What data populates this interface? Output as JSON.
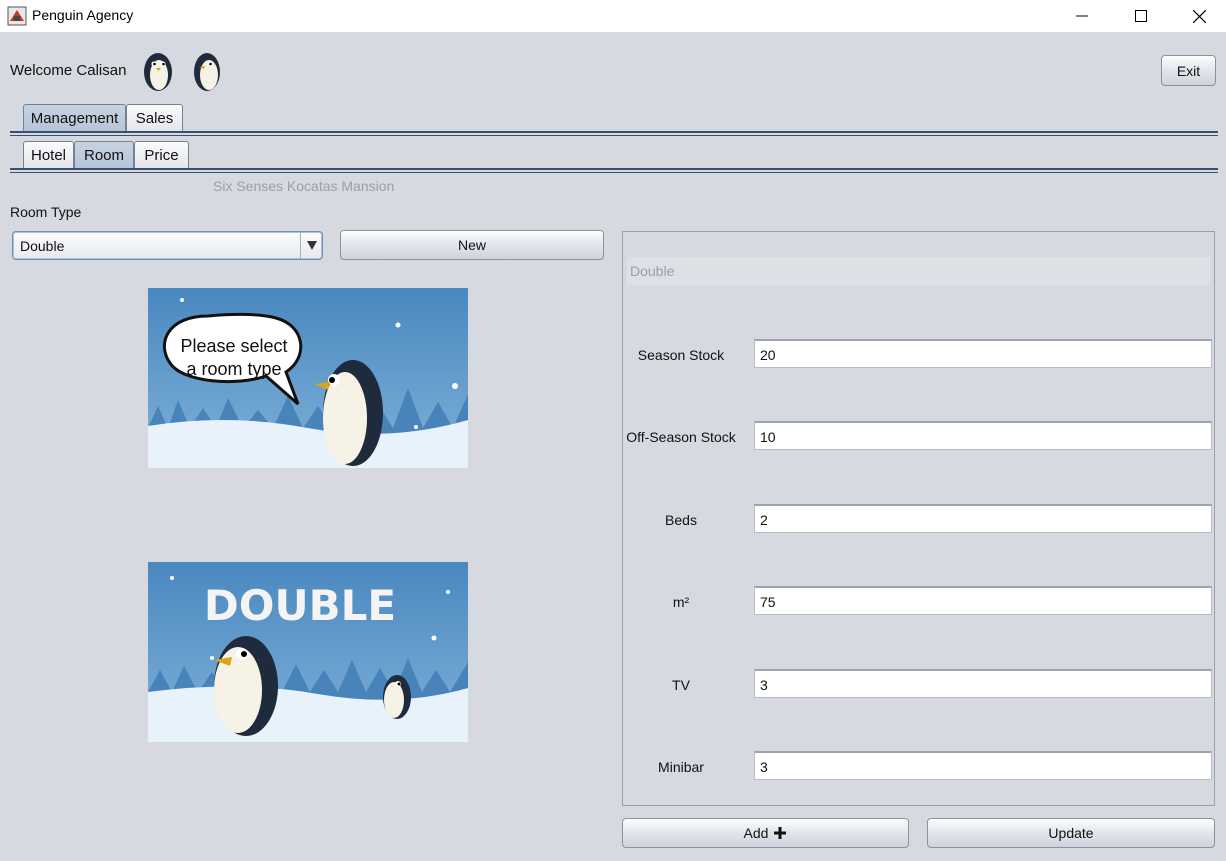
{
  "window": {
    "title": "Penguin Agency"
  },
  "header": {
    "welcome": "Welcome Calisan",
    "exit_label": "Exit"
  },
  "main_tabs": [
    {
      "label": "Management",
      "active": true
    },
    {
      "label": "Sales",
      "active": false
    }
  ],
  "sub_tabs": [
    {
      "label": "Hotel",
      "active": false
    },
    {
      "label": "Room",
      "active": true
    },
    {
      "label": "Price",
      "active": false
    }
  ],
  "hotel_name": "Six Senses Kocatas Mansion",
  "room_type": {
    "label": "Room Type",
    "selected": "Double",
    "new_label": "New"
  },
  "images": {
    "prompt_line1": "Please select",
    "prompt_line2": "a room type",
    "room_banner": "DOUBLE"
  },
  "details": {
    "title_value": "Double",
    "fields": [
      {
        "label": "Season Stock",
        "value": "20"
      },
      {
        "label": "Off-Season Stock",
        "value": "10"
      },
      {
        "label": "Beds",
        "value": "2"
      },
      {
        "label": "m²",
        "value": "75"
      },
      {
        "label": "TV",
        "value": "3"
      },
      {
        "label": "Minibar",
        "value": "3"
      }
    ]
  },
  "actions": {
    "add_label": "Add",
    "update_label": "Update"
  },
  "colors": {
    "background": "#d6d9df",
    "tab_active": "#b9c8db",
    "tab_rule": "#3a4f6e",
    "sky": "#4f8dc2",
    "snow": "#e8f2fa"
  }
}
